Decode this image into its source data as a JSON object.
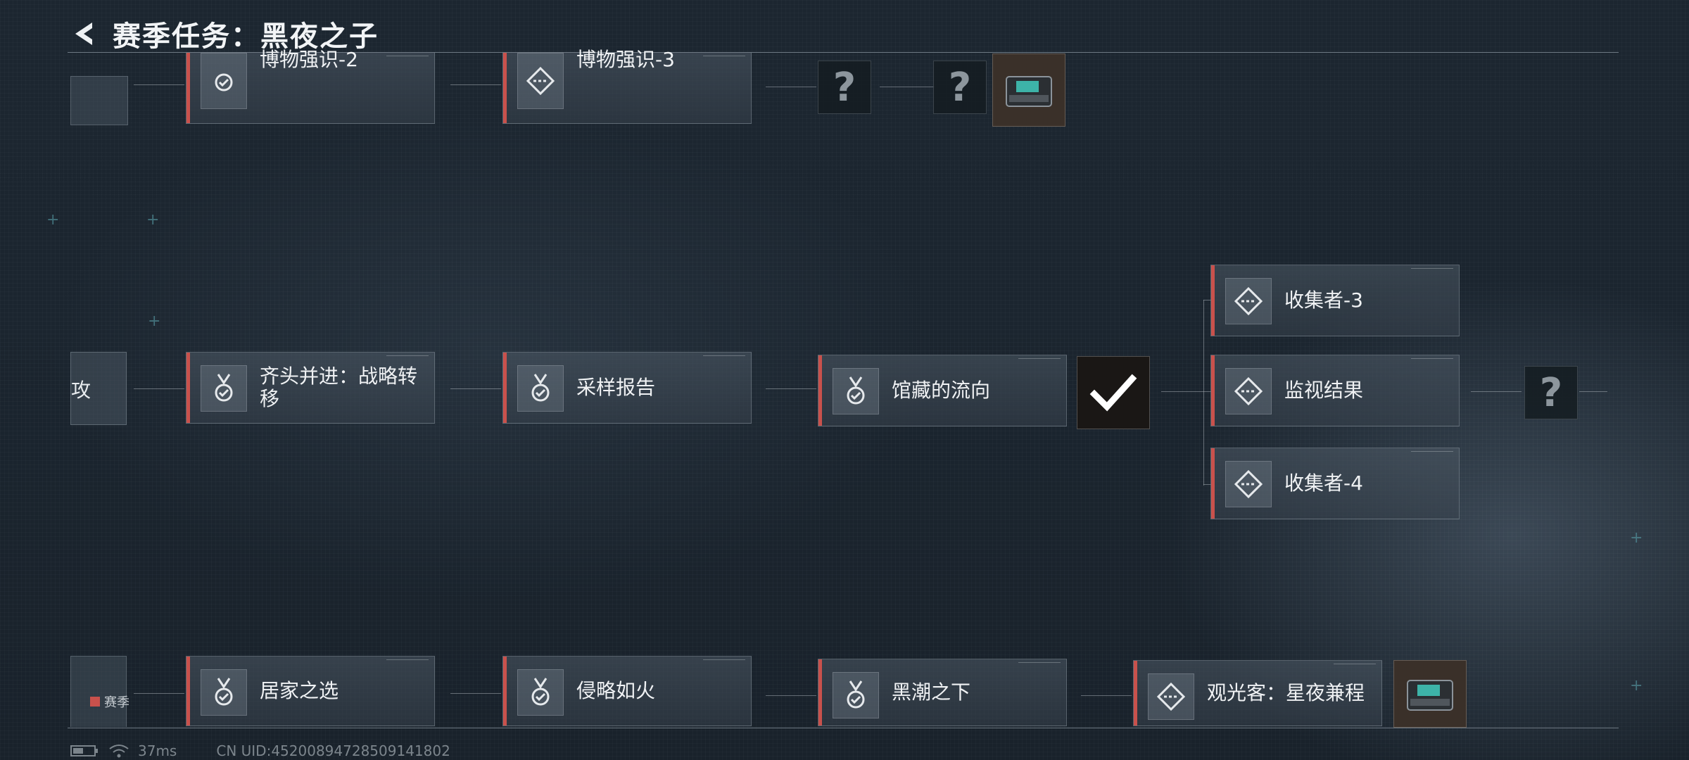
{
  "header": {
    "title": "赛季任务：黑夜之子"
  },
  "rows": {
    "top": [
      {
        "label": "博物强识-2",
        "icon": "medal-check-icon"
      },
      {
        "label": "博物强识-3",
        "icon": "diamond-dash-icon"
      }
    ],
    "middle": [
      {
        "label": "齐头并进：战略转移",
        "icon": "medal-check-icon"
      },
      {
        "label": "采样报告",
        "icon": "medal-check-icon"
      },
      {
        "label": "馆藏的流向",
        "icon": "medal-check-icon"
      }
    ],
    "branch": [
      {
        "label": "收集者-3",
        "icon": "diamond-dash-icon"
      },
      {
        "label": "监视结果",
        "icon": "diamond-dash-icon"
      },
      {
        "label": "收集者-4",
        "icon": "diamond-dash-icon"
      }
    ],
    "bottom": [
      {
        "label": "居家之选",
        "icon": "medal-check-icon"
      },
      {
        "label": "侵略如火",
        "icon": "medal-check-icon"
      },
      {
        "label": "黑潮之下",
        "icon": "medal-check-icon"
      },
      {
        "label": "观光客：星夜兼程",
        "icon": "diamond-dash-icon"
      }
    ]
  },
  "partial_left_label": "攻",
  "unknown_glyph": "?",
  "legend": {
    "label": "赛季",
    "color": "#c9514c"
  },
  "status": {
    "ping": "37ms",
    "uid": "CN UID:4520089472850914180​2"
  },
  "colors": {
    "accent": "#c9514c",
    "background": "#1b252f"
  }
}
